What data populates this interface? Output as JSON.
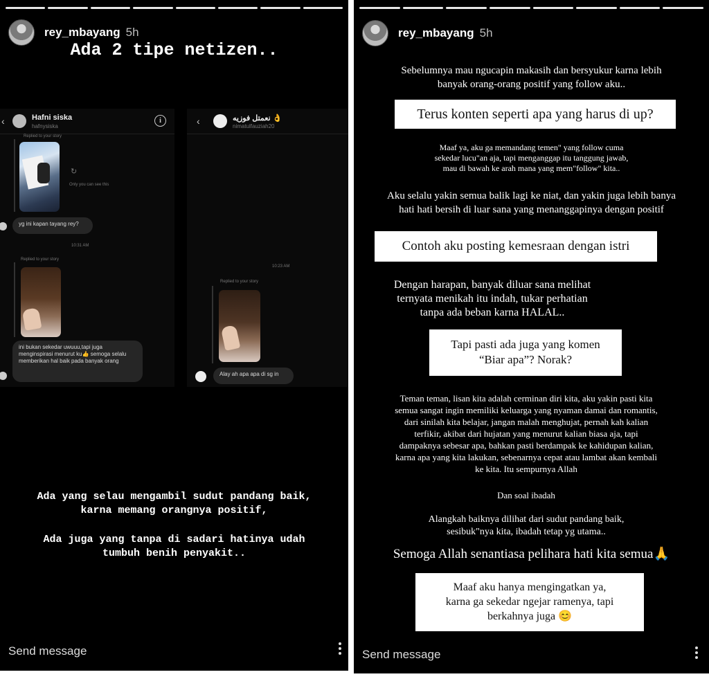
{
  "left_story": {
    "username": "rey_mbayang",
    "time": "5h",
    "title": "Ada 2 tipe netizen..",
    "dm_left": {
      "name": "Hafni siska",
      "username": "hafnysiska",
      "replied_label_1": "Replied to your story",
      "only_you": "Only you can see this",
      "message_1": "yg ini kapan tayang rey?",
      "timestamp": "10:31 AM",
      "replied_label_2": "Replied to your story",
      "message_2": "ini  bukan sekedar uwuuu,tapi juga menginspirasi menurut ku👍 semoga selalu memberikan hal baik pada banyak orang"
    },
    "dm_right": {
      "name": "نعمتل فوزيه 👌",
      "username": "nimatulfauziah20",
      "timestamp": "10:23 AM",
      "replied_label": "Replied to your story",
      "message": "Alay ah apa apa di sg in"
    },
    "caption_1": "Ada yang selau mengambil sudut pandang baik,\nkarna memang orangnya positif,",
    "caption_2": "Ada juga yang tanpa di sadari hatinya udah\ntumbuh benih penyakit..",
    "send_message": "Send message"
  },
  "right_story": {
    "username": "rey_mbayang",
    "time": "5h",
    "para_1": "Sebelumnya mau ngucapin makasih dan bersyukur karna lebih\nbanyak orang-orang positif yang follow aku..",
    "box_1": "Terus konten seperti apa yang harus di up?",
    "para_2": "Maaf ya, aku ga memandang temen\" yang follow cuma\nsekedar lucu\"an aja, tapi menganggap itu tanggung jawab,\nmau di bawah ke arah mana yang mem\"follow\" kita..",
    "para_3": "Aku selalu yakin semua balik lagi ke niat, dan yakin juga lebih banya\nhati hati bersih di luar sana yang menanggapinya dengan positif",
    "box_2": "Contoh aku posting kemesraan dengan istri",
    "para_4": "Dengan harapan, banyak diluar sana melihat\nternyata menikah itu indah, tukar perhatian\ntanpa ada beban karna HALAL..",
    "box_3": "Tapi pasti ada juga yang komen\n“Biar apa”? Norak?",
    "para_5": "Teman teman, lisan kita adalah cerminan diri kita, aku yakin pasti kita\nsemua  sangat ingin memiliki keluarga yang nyaman damai dan romantis,\ndari sinilah kita belajar, jangan malah menghujat, pernah kah kalian\nterfikir, akibat dari hujatan yang menurut kalian biasa aja, tapi\ndampaknya sebesar apa, bahkan pasti berdampak ke kahidupan kalian,\nkarna apa yang kita lakukan, sebenarnya cepat atau lambat akan kembali\nke kita. Itu sempurnya Allah",
    "para_6": "Dan soal ibadah",
    "para_7": "Alangkah baiknya dilihat dari sudut pandang baik,\nsesibuk\"nya kita, ibadah tetap yg utama..",
    "para_8": "Semoga Allah senantiasa pelihara hati kita semua🙏",
    "box_4": "Maaf aku hanya mengingatkan ya,\nkarna ga sekedar ngejar ramenya, tapi\nberkahnya juga 😊",
    "send_message": "Send message"
  },
  "icons": {
    "more": "more-options-icon",
    "back": "back-arrow-icon",
    "info": "info-icon",
    "reload": "reload-icon"
  }
}
